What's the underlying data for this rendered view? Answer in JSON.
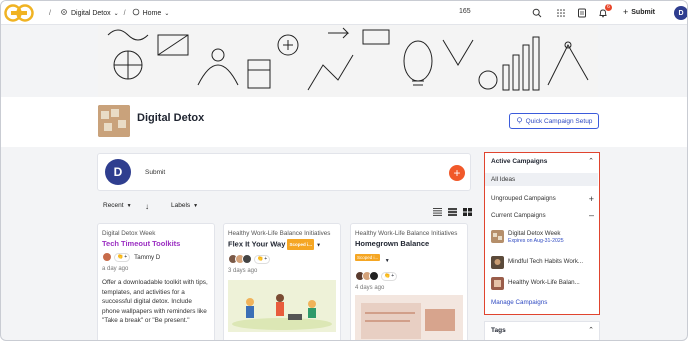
{
  "topbar": {
    "crumb_slash": "/",
    "workspace": "Digital Detox",
    "home": "Home",
    "count": "165",
    "notif_count": "6",
    "submit_label": "Submit",
    "user_initial": "D"
  },
  "page": {
    "title": "Digital Detox",
    "quick_campaign_label": "Quick Campaign Setup"
  },
  "submit_box": {
    "avatar_initial": "D",
    "placeholder": "Submit"
  },
  "sort": {
    "recent_label": "Recent",
    "labels_label": "Labels"
  },
  "cards": [
    {
      "category": "Digital Detox Week",
      "title": "Tech Timeout Toolkits",
      "author": "Tammy D",
      "time": "a day ago",
      "body": "Offer a downloadable toolkit with tips, templates, and activities for a successful digital detox. Include phone wallpapers with reminders like \"Take a break\" or \"Be present.\""
    },
    {
      "category": "Healthy Work-Life Balance Initiatives",
      "title": "Flex It Your Way",
      "badge": "Scoped i...",
      "time": "3 days ago"
    },
    {
      "category": "Healthy Work-Life Balance Initiatives",
      "title": "Homegrown Balance",
      "badge": "Scoped i...",
      "time": "4 days ago"
    }
  ],
  "panel": {
    "active_campaigns": "Active Campaigns",
    "all_ideas": "All Ideas",
    "ungrouped": "Ungrouped Campaigns",
    "current": "Current Campaigns",
    "campaigns": [
      {
        "name": "Digital Detox Week",
        "expires": "Expires on Aug-31-2025"
      },
      {
        "name": "Mindful Tech Habits Work..."
      },
      {
        "name": "Healthy Work-Life Balan..."
      }
    ],
    "manage": "Manage Campaigns",
    "tags": "Tags"
  },
  "colors": {
    "accent_blue": "#2f4ac2",
    "brand_orange": "#f1592a",
    "highlight_red": "#e0442e",
    "title_purple": "#9b2fc2"
  }
}
